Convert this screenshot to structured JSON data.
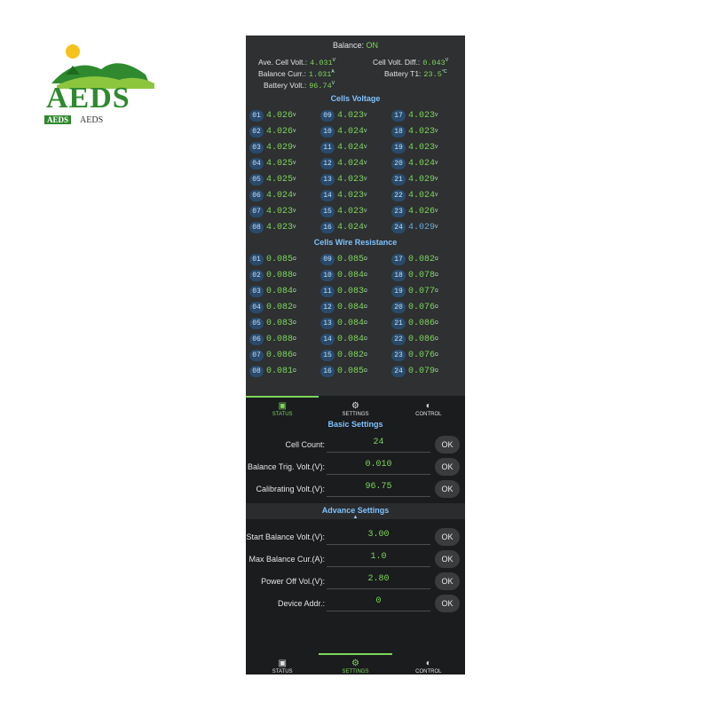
{
  "logo": {
    "text": "AEDS",
    "badge": "AEDS",
    "sub": "AEDS"
  },
  "summary": {
    "balance_label": "Balance:",
    "balance_value": "ON",
    "ave_label": "Ave. Cell Volt.:",
    "ave_value": "4.031",
    "ave_unit": "V",
    "diff_label": "Cell Volt. Diff.:",
    "diff_value": "0.043",
    "diff_unit": "V",
    "curr_label": "Balance Curr.:",
    "curr_value": "1.031",
    "curr_unit": "A",
    "t1_label": "Battery T1:",
    "t1_value": "23.5",
    "t1_unit": "°C",
    "bv_label": "Battery Volt.:",
    "bv_value": "96.74",
    "bv_unit": "V"
  },
  "cells_voltage": {
    "title": "Cells Voltage",
    "unit": "V",
    "cells": [
      {
        "n": "01",
        "v": "4.026"
      },
      {
        "n": "09",
        "v": "4.023"
      },
      {
        "n": "17",
        "v": "4.023"
      },
      {
        "n": "02",
        "v": "4.026"
      },
      {
        "n": "10",
        "v": "4.024"
      },
      {
        "n": "18",
        "v": "4.023"
      },
      {
        "n": "03",
        "v": "4.029"
      },
      {
        "n": "11",
        "v": "4.024"
      },
      {
        "n": "19",
        "v": "4.023"
      },
      {
        "n": "04",
        "v": "4.025"
      },
      {
        "n": "12",
        "v": "4.024"
      },
      {
        "n": "20",
        "v": "4.024"
      },
      {
        "n": "05",
        "v": "4.025"
      },
      {
        "n": "13",
        "v": "4.023"
      },
      {
        "n": "21",
        "v": "4.029"
      },
      {
        "n": "06",
        "v": "4.024"
      },
      {
        "n": "14",
        "v": "4.023"
      },
      {
        "n": "22",
        "v": "4.024"
      },
      {
        "n": "07",
        "v": "4.023"
      },
      {
        "n": "15",
        "v": "4.023"
      },
      {
        "n": "23",
        "v": "4.026"
      },
      {
        "n": "08",
        "v": "4.023"
      },
      {
        "n": "16",
        "v": "4.024"
      },
      {
        "n": "24",
        "v": "4.029",
        "highlight": "blue"
      }
    ]
  },
  "cells_resistance": {
    "title": "Cells Wire Resistance",
    "unit": "Ω",
    "cells": [
      {
        "n": "01",
        "v": "0.085"
      },
      {
        "n": "09",
        "v": "0.085"
      },
      {
        "n": "17",
        "v": "0.082"
      },
      {
        "n": "02",
        "v": "0.088"
      },
      {
        "n": "10",
        "v": "0.084"
      },
      {
        "n": "18",
        "v": "0.078"
      },
      {
        "n": "03",
        "v": "0.084"
      },
      {
        "n": "11",
        "v": "0.083"
      },
      {
        "n": "19",
        "v": "0.077"
      },
      {
        "n": "04",
        "v": "0.082"
      },
      {
        "n": "12",
        "v": "0.084"
      },
      {
        "n": "20",
        "v": "0.076"
      },
      {
        "n": "05",
        "v": "0.083"
      },
      {
        "n": "13",
        "v": "0.084"
      },
      {
        "n": "21",
        "v": "0.086"
      },
      {
        "n": "06",
        "v": "0.088"
      },
      {
        "n": "14",
        "v": "0.084"
      },
      {
        "n": "22",
        "v": "0.086"
      },
      {
        "n": "07",
        "v": "0.086"
      },
      {
        "n": "15",
        "v": "0.082"
      },
      {
        "n": "23",
        "v": "0.076"
      },
      {
        "n": "08",
        "v": "0.081"
      },
      {
        "n": "16",
        "v": "0.085"
      },
      {
        "n": "24",
        "v": "0.079"
      }
    ]
  },
  "tabs": [
    {
      "label": "STATUS",
      "icon": "status-icon"
    },
    {
      "label": "SETTINGS",
      "icon": "gear-icon"
    },
    {
      "label": "CONTROL",
      "icon": "toggle-icon"
    }
  ],
  "top_tabbar_active": "STATUS",
  "bottom_tabbar_active": "SETTINGS",
  "basic_settings": {
    "title": "Basic Settings",
    "rows": [
      {
        "label": "Cell Count:",
        "value": "24",
        "button": "OK"
      },
      {
        "label": "Balance Trig. Volt.(V):",
        "value": "0.010",
        "button": "OK"
      },
      {
        "label": "Calibrating Volt.(V):",
        "value": "96.75",
        "button": "OK"
      }
    ]
  },
  "advance_settings": {
    "title": "Advance Settings",
    "rows": [
      {
        "label": "Start Balance Volt.(V):",
        "value": "3.00",
        "button": "OK"
      },
      {
        "label": "Max Balance Cur.(A):",
        "value": "1.0",
        "button": "OK"
      },
      {
        "label": "Power Off Vol.(V):",
        "value": "2.80",
        "button": "OK"
      },
      {
        "label": "Device Addr.:",
        "value": "0",
        "button": "OK"
      }
    ]
  },
  "colors": {
    "value_green": "#7bd65a",
    "title_blue": "#7fc1ff",
    "panel": "#2e3031",
    "screen_bg": "#1b1c1e"
  }
}
